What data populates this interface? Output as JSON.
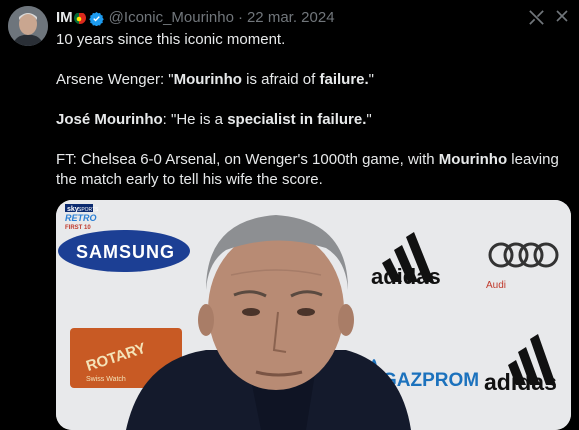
{
  "tweet": {
    "display_name": "IM",
    "handle": "@Iconic_Mourinho",
    "separator": "·",
    "date": "22 mar. 2024",
    "line1": "10 years since this iconic moment.",
    "line2": {
      "a": "Arsene Wenger: \"",
      "b": "Mourinho",
      "c": " is afraid of ",
      "d": "failure.",
      "e": "\""
    },
    "line3": {
      "a": "José Mourinho",
      "b": ": \"He is a ",
      "c": "specialist in failure.",
      "d": "\""
    },
    "line4": {
      "a": "FT: Chelsea 6-0 Arsenal, on Wenger's 1000th game, with ",
      "b": "Mourinho",
      "c": " leaving the match early to tell his wife the score."
    }
  },
  "media": {
    "texts": {
      "sky": "sky",
      "sky_sub": "SPORTS",
      "retro1": "RETRO",
      "retro2": "FIRST 10",
      "samsung": "SAMSUNG",
      "adidas1": "adidas",
      "audi": "Audi",
      "rotary": "ROTARY",
      "rotary_sub": "Swiss Watch",
      "gazprom": "GAZPROM",
      "adidas2": "adidas"
    }
  },
  "colors": {
    "background": "#000000",
    "text": "#e7e9ea",
    "muted": "#71767b",
    "verified": "#1d9bf0",
    "samsung": "#1c3f94"
  }
}
